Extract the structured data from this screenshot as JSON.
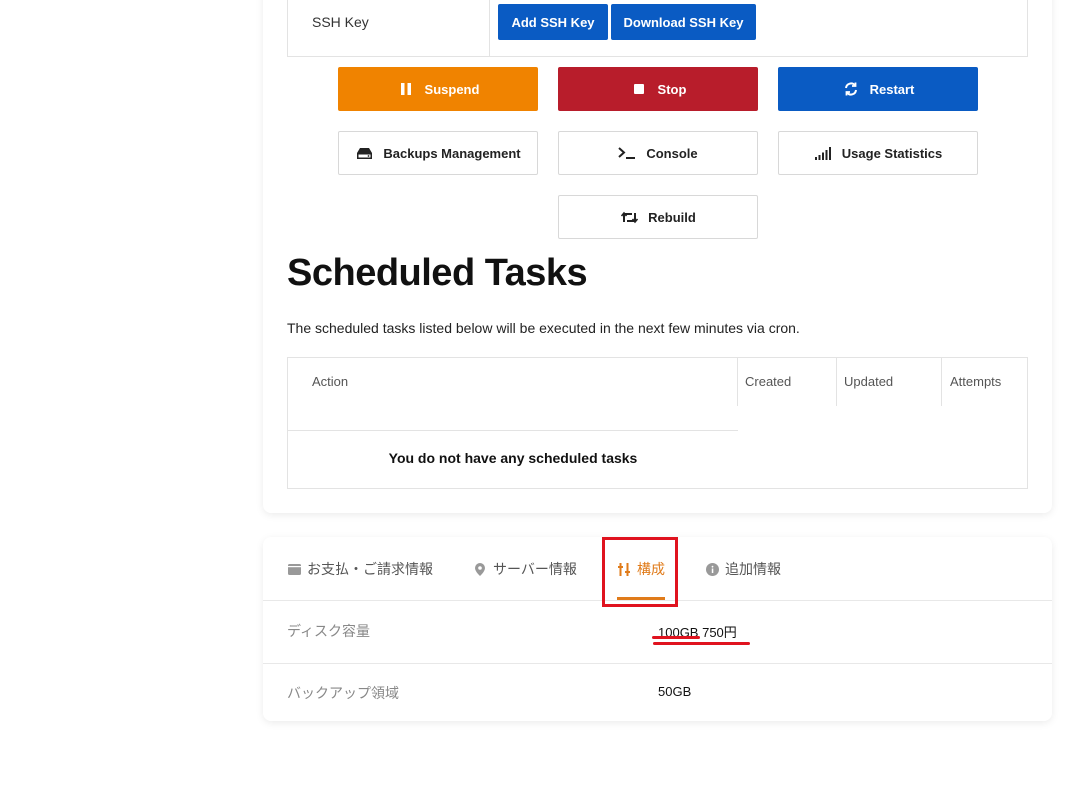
{
  "ssh": {
    "label": "SSH Key",
    "add_label": "Add SSH Key",
    "download_label": "Download SSH Key"
  },
  "actions": {
    "suspend": "Suspend",
    "stop": "Stop",
    "restart": "Restart",
    "backups": "Backups Management",
    "console": "Console",
    "usage": "Usage Statistics",
    "rebuild": "Rebuild"
  },
  "scheduled": {
    "title": "Scheduled Tasks",
    "description": "The scheduled tasks listed below will be executed in the next few minutes via cron.",
    "columns": [
      "Action",
      "Created",
      "Updated",
      "Attempts"
    ],
    "empty": "You do not have any scheduled tasks"
  },
  "tabs": [
    {
      "label": "お支払・ご請求情報",
      "icon": "wallet-icon"
    },
    {
      "label": "サーバー情報",
      "icon": "map-pin-icon"
    },
    {
      "label": "構成",
      "icon": "sliders-icon",
      "active": true
    },
    {
      "label": "追加情報",
      "icon": "info-icon"
    }
  ],
  "specs": [
    {
      "label": "ディスク容量",
      "value": "100GB 750円"
    },
    {
      "label": "バックアップ領域",
      "value": "50GB"
    }
  ],
  "colors": {
    "suspend": "#f08300",
    "stop": "#b81d2b",
    "primary": "#0a5bc3",
    "active_tab": "#e07b1a",
    "annotation": "#e0131f"
  }
}
